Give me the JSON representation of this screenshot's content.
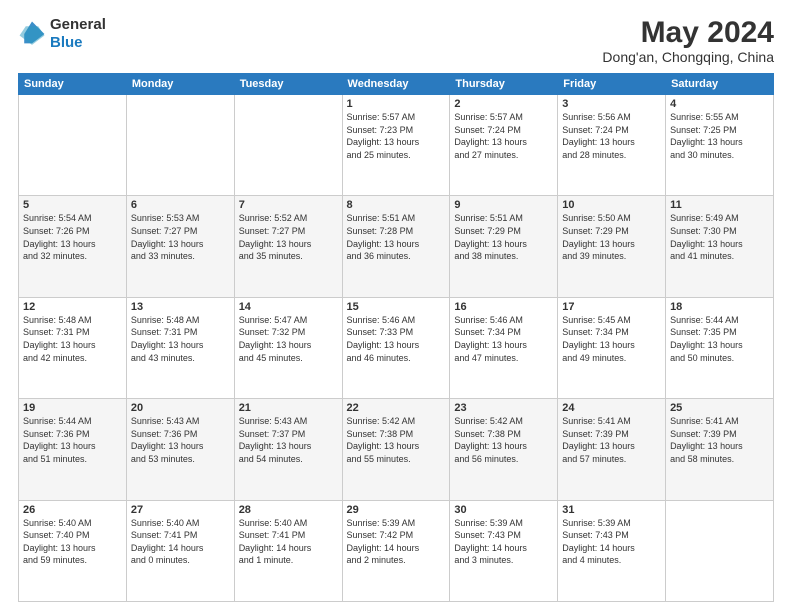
{
  "header": {
    "logo_line1": "General",
    "logo_line2": "Blue",
    "main_title": "May 2024",
    "sub_title": "Dong'an, Chongqing, China"
  },
  "weekdays": [
    "Sunday",
    "Monday",
    "Tuesday",
    "Wednesday",
    "Thursday",
    "Friday",
    "Saturday"
  ],
  "weeks": [
    [
      {
        "day": "",
        "info": ""
      },
      {
        "day": "",
        "info": ""
      },
      {
        "day": "",
        "info": ""
      },
      {
        "day": "1",
        "info": "Sunrise: 5:57 AM\nSunset: 7:23 PM\nDaylight: 13 hours\nand 25 minutes."
      },
      {
        "day": "2",
        "info": "Sunrise: 5:57 AM\nSunset: 7:24 PM\nDaylight: 13 hours\nand 27 minutes."
      },
      {
        "day": "3",
        "info": "Sunrise: 5:56 AM\nSunset: 7:24 PM\nDaylight: 13 hours\nand 28 minutes."
      },
      {
        "day": "4",
        "info": "Sunrise: 5:55 AM\nSunset: 7:25 PM\nDaylight: 13 hours\nand 30 minutes."
      }
    ],
    [
      {
        "day": "5",
        "info": "Sunrise: 5:54 AM\nSunset: 7:26 PM\nDaylight: 13 hours\nand 32 minutes."
      },
      {
        "day": "6",
        "info": "Sunrise: 5:53 AM\nSunset: 7:27 PM\nDaylight: 13 hours\nand 33 minutes."
      },
      {
        "day": "7",
        "info": "Sunrise: 5:52 AM\nSunset: 7:27 PM\nDaylight: 13 hours\nand 35 minutes."
      },
      {
        "day": "8",
        "info": "Sunrise: 5:51 AM\nSunset: 7:28 PM\nDaylight: 13 hours\nand 36 minutes."
      },
      {
        "day": "9",
        "info": "Sunrise: 5:51 AM\nSunset: 7:29 PM\nDaylight: 13 hours\nand 38 minutes."
      },
      {
        "day": "10",
        "info": "Sunrise: 5:50 AM\nSunset: 7:29 PM\nDaylight: 13 hours\nand 39 minutes."
      },
      {
        "day": "11",
        "info": "Sunrise: 5:49 AM\nSunset: 7:30 PM\nDaylight: 13 hours\nand 41 minutes."
      }
    ],
    [
      {
        "day": "12",
        "info": "Sunrise: 5:48 AM\nSunset: 7:31 PM\nDaylight: 13 hours\nand 42 minutes."
      },
      {
        "day": "13",
        "info": "Sunrise: 5:48 AM\nSunset: 7:31 PM\nDaylight: 13 hours\nand 43 minutes."
      },
      {
        "day": "14",
        "info": "Sunrise: 5:47 AM\nSunset: 7:32 PM\nDaylight: 13 hours\nand 45 minutes."
      },
      {
        "day": "15",
        "info": "Sunrise: 5:46 AM\nSunset: 7:33 PM\nDaylight: 13 hours\nand 46 minutes."
      },
      {
        "day": "16",
        "info": "Sunrise: 5:46 AM\nSunset: 7:34 PM\nDaylight: 13 hours\nand 47 minutes."
      },
      {
        "day": "17",
        "info": "Sunrise: 5:45 AM\nSunset: 7:34 PM\nDaylight: 13 hours\nand 49 minutes."
      },
      {
        "day": "18",
        "info": "Sunrise: 5:44 AM\nSunset: 7:35 PM\nDaylight: 13 hours\nand 50 minutes."
      }
    ],
    [
      {
        "day": "19",
        "info": "Sunrise: 5:44 AM\nSunset: 7:36 PM\nDaylight: 13 hours\nand 51 minutes."
      },
      {
        "day": "20",
        "info": "Sunrise: 5:43 AM\nSunset: 7:36 PM\nDaylight: 13 hours\nand 53 minutes."
      },
      {
        "day": "21",
        "info": "Sunrise: 5:43 AM\nSunset: 7:37 PM\nDaylight: 13 hours\nand 54 minutes."
      },
      {
        "day": "22",
        "info": "Sunrise: 5:42 AM\nSunset: 7:38 PM\nDaylight: 13 hours\nand 55 minutes."
      },
      {
        "day": "23",
        "info": "Sunrise: 5:42 AM\nSunset: 7:38 PM\nDaylight: 13 hours\nand 56 minutes."
      },
      {
        "day": "24",
        "info": "Sunrise: 5:41 AM\nSunset: 7:39 PM\nDaylight: 13 hours\nand 57 minutes."
      },
      {
        "day": "25",
        "info": "Sunrise: 5:41 AM\nSunset: 7:39 PM\nDaylight: 13 hours\nand 58 minutes."
      }
    ],
    [
      {
        "day": "26",
        "info": "Sunrise: 5:40 AM\nSunset: 7:40 PM\nDaylight: 13 hours\nand 59 minutes."
      },
      {
        "day": "27",
        "info": "Sunrise: 5:40 AM\nSunset: 7:41 PM\nDaylight: 14 hours\nand 0 minutes."
      },
      {
        "day": "28",
        "info": "Sunrise: 5:40 AM\nSunset: 7:41 PM\nDaylight: 14 hours\nand 1 minute."
      },
      {
        "day": "29",
        "info": "Sunrise: 5:39 AM\nSunset: 7:42 PM\nDaylight: 14 hours\nand 2 minutes."
      },
      {
        "day": "30",
        "info": "Sunrise: 5:39 AM\nSunset: 7:43 PM\nDaylight: 14 hours\nand 3 minutes."
      },
      {
        "day": "31",
        "info": "Sunrise: 5:39 AM\nSunset: 7:43 PM\nDaylight: 14 hours\nand 4 minutes."
      },
      {
        "day": "",
        "info": ""
      }
    ]
  ]
}
